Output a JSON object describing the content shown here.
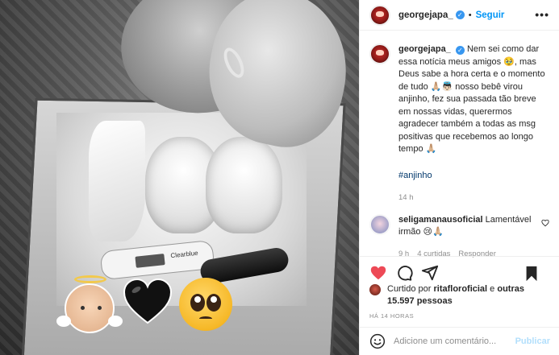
{
  "post": {
    "username": "georgejapa_",
    "follow_label": "Seguir",
    "more_icon": "more-icon",
    "caption_username": "georgejapa_",
    "caption_text": "Nem sei como dar essa notícia meus amigos 🥹, mas Deus sabe a hora certa e o momento de tudo 🙏🏼👼🏻 nosso bebê virou anjinho, fez sua passada tão breve em nossas vidas, querermos agradecer também a todas as msg positivas que recebemos ao longo tempo 🙏🏼",
    "hashtag": "#anjinho",
    "caption_time": "14 h"
  },
  "photo": {
    "test_brand": "Clearblue"
  },
  "comment": {
    "username": "seligamanausoficial",
    "text": "Lamentável irmão 😢🙏🏼",
    "time": "9 h",
    "likes": "4 curtidas",
    "reply": "Responder"
  },
  "likes": {
    "prefix": "Curtido por ",
    "user": "ritafloroficial",
    "middle": " e ",
    "others": "outras 15.597 pessoas"
  },
  "timeago": "HÁ 14 HORAS",
  "add_comment": {
    "placeholder": "Adicione um comentário...",
    "publish_label": "Publicar"
  },
  "colors": {
    "accent": "#0095f6",
    "like_red": "#ed4956",
    "hashtag": "#00376b",
    "muted": "#8e8e8e"
  }
}
